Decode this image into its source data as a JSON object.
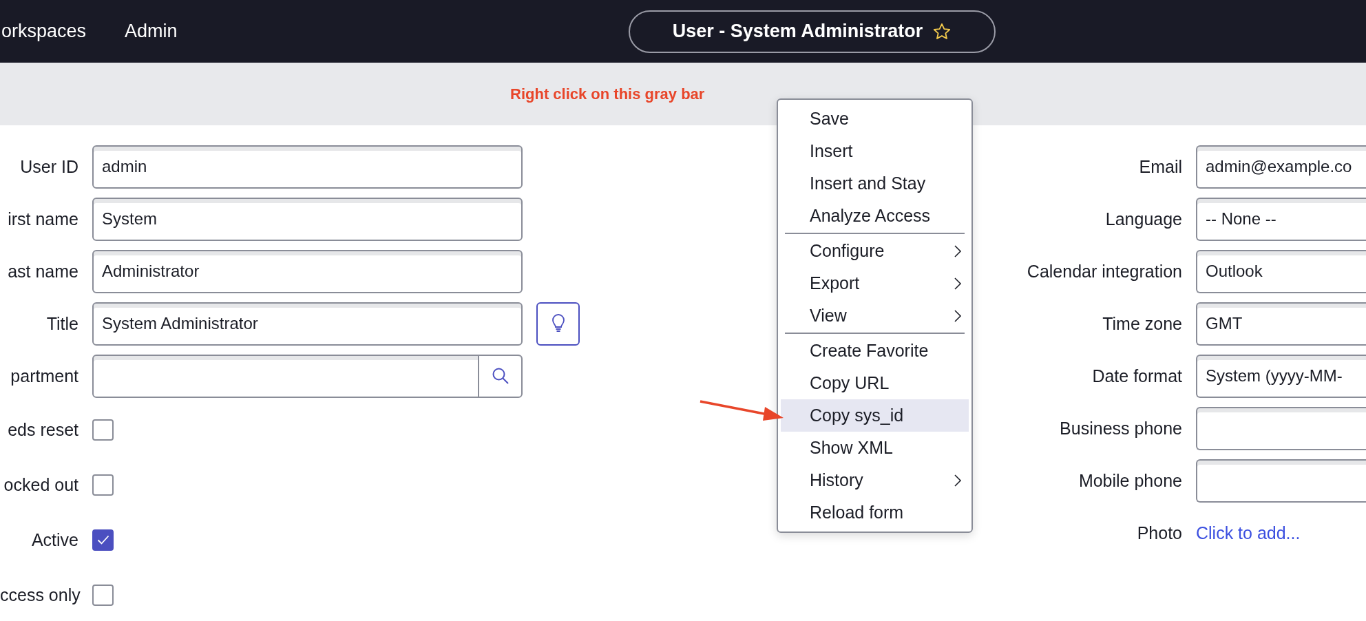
{
  "top_nav": {
    "items": [
      "orkspaces",
      "Admin"
    ],
    "record_title": "User - System Administrator",
    "favorite": false
  },
  "banner": {
    "instruction": "Right click on this gray bar"
  },
  "form": {
    "left_fields": [
      {
        "kind": "text",
        "label": "User ID",
        "value": "admin"
      },
      {
        "kind": "text",
        "label": "irst name",
        "value": "System"
      },
      {
        "kind": "text",
        "label": "ast name",
        "value": "Administrator"
      },
      {
        "kind": "text",
        "label": "Title",
        "value": "System Administrator",
        "suggestion_button": true
      },
      {
        "kind": "reference",
        "label": "partment"
      },
      {
        "kind": "checkbox",
        "label": "eds reset",
        "checked": false
      },
      {
        "kind": "checkbox",
        "label": "ocked out",
        "checked": false
      },
      {
        "kind": "checkbox",
        "label": "Active",
        "checked": true
      },
      {
        "kind": "checkbox",
        "label": "ccess only",
        "checked": false
      }
    ],
    "right_fields": [
      {
        "kind": "text",
        "label": "Email",
        "value": "admin@example.co"
      },
      {
        "kind": "text",
        "label": "Language",
        "value": "-- None --"
      },
      {
        "kind": "text",
        "label": "Calendar integration",
        "value": "Outlook"
      },
      {
        "kind": "text",
        "label": "Time zone",
        "value": "GMT"
      },
      {
        "kind": "text",
        "label": "Date format",
        "value": "System (yyyy-MM-"
      },
      {
        "kind": "text",
        "label": "Business phone"
      },
      {
        "kind": "text",
        "label": "Mobile phone"
      },
      {
        "kind": "link",
        "label": "Photo",
        "link": "Click to add..."
      }
    ]
  },
  "context_menu": {
    "groups": [
      [
        {
          "label": "Save",
          "submenu": false,
          "selected": false
        },
        {
          "label": "Insert",
          "submenu": false,
          "selected": false
        },
        {
          "label": "Insert and Stay",
          "submenu": false,
          "selected": false
        },
        {
          "label": "Analyze Access",
          "submenu": false,
          "selected": false
        }
      ],
      [
        {
          "label": "Configure",
          "submenu": true,
          "selected": false
        },
        {
          "label": "Export",
          "submenu": true,
          "selected": false
        },
        {
          "label": "View",
          "submenu": true,
          "selected": false
        }
      ],
      [
        {
          "label": "Create Favorite",
          "submenu": false,
          "selected": false
        },
        {
          "label": "Copy URL",
          "submenu": false,
          "selected": false
        },
        {
          "label": "Copy sys_id",
          "submenu": false,
          "selected": true
        },
        {
          "label": "Show XML",
          "submenu": false,
          "selected": false
        },
        {
          "label": "History",
          "submenu": true,
          "selected": false
        },
        {
          "label": "Reload form",
          "submenu": false,
          "selected": false
        }
      ]
    ]
  }
}
